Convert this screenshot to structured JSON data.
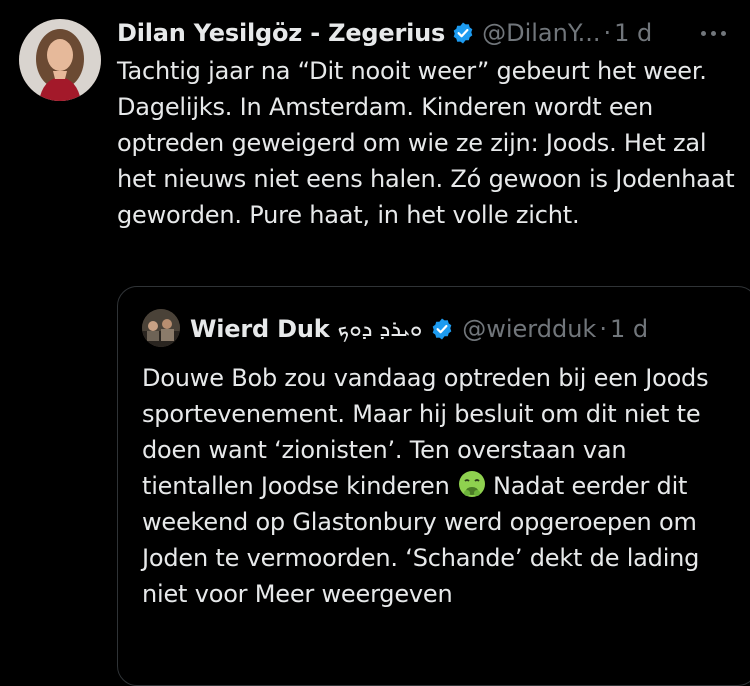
{
  "tweet": {
    "author": {
      "display_name": "Dilan Yesilgöz - Zegerius",
      "handle": "@DilanY...",
      "verified": true
    },
    "time": "1 d",
    "text": "Tachtig jaar na “Dit nooit weer” gebeurt het weer. Dagelijks. In Amsterdam. Kinderen wordt een optreden geweigerd om wie ze zijn: Joods. Het zal het nieuws niet eens halen. Zó gewoon is Jodenhaat geworden. Pure haat, in het volle zicht."
  },
  "quote": {
    "author": {
      "display_name": "Wierd Duk",
      "name_script": "ܘܝܪܕ ܕܘܟ",
      "handle": "@wierdduk",
      "verified": true
    },
    "time": "1 d",
    "text_before_emoji": "Douwe Bob zou vandaag optreden bij een Joods sportevenement. Maar hij besluit om dit niet te doen want ‘zionisten’. Ten overstaan van tientallen Joodse kinderen",
    "emoji": "nauseated-face-emoji",
    "text_after_emoji": "Nadat eerder dit weekend op Glastonbury werd opgeroepen om Joden te vermoorden. ‘Schande’ dekt de lading niet",
    "show_more": "voor Meer weergeven"
  },
  "icons": {
    "verified": "verified-badge-icon",
    "more": "more-options-icon"
  },
  "colors": {
    "background": "#000000",
    "text": "#e7e9ea",
    "secondary_text": "#71767b",
    "verified_blue": "#1d9bf0",
    "border": "#2f3336"
  }
}
